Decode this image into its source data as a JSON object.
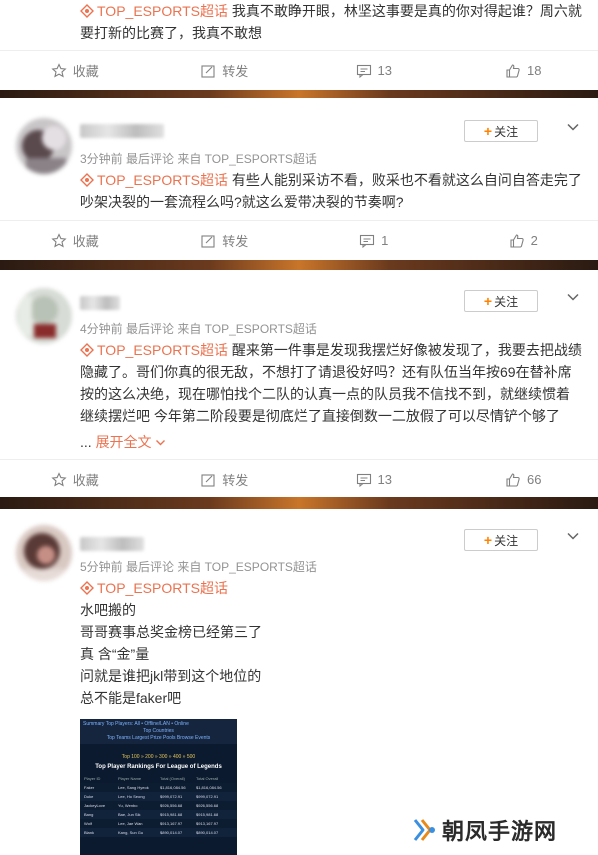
{
  "posts": [
    {
      "text_topic": "TOP_ESPORTS超话",
      "text": " 我真不敢睁开眼，林坚这事要是真的你对得起谁？周六就要打新的比赛了，我真不敢想",
      "actions": {
        "favorite": "收藏",
        "repost": "转发",
        "comments": "13",
        "likes": "18"
      }
    },
    {
      "meta": "3分钟前 最后评论 来自 TOP_ESPORTS超话",
      "follow_label": "关注",
      "text_topic": "TOP_ESPORTS超话",
      "text": " 有些人能别采访不看，败采也不看就这么自问自答走完了吵架决裂的一套流程么吗?就这么爱带决裂的节奏啊?",
      "actions": {
        "favorite": "收藏",
        "repost": "转发",
        "comments": "1",
        "likes": "2"
      }
    },
    {
      "meta": "4分钟前 最后评论 来自 TOP_ESPORTS超话",
      "follow_label": "关注",
      "text_topic": "TOP_ESPORTS超话",
      "text": " 醒来第一件事是发现我摆烂好像被发现了，我要去把战绩隐藏了。哥们你真的很无敌，不想打了请退役好吗？还有队伍当年按69在替补席按的这么决绝，现在哪怕找个二队的认真一点的队员我不信找不到，就继续惯着继续摆烂吧 今年第二阶段要是彻底烂了直接倒数一二放假了可以尽情铲个够了",
      "expand_prefix": "...",
      "expand_label": "展开全文",
      "actions": {
        "favorite": "收藏",
        "repost": "转发",
        "comments": "13",
        "likes": "66"
      }
    },
    {
      "meta": "5分钟前 最后评论 来自 TOP_ESPORTS超话",
      "follow_label": "关注",
      "text_topic": "TOP_ESPORTS超话",
      "lines": [
        "水吧搬的",
        "哥哥赛事总奖金榜已经第三了",
        "真 含“金”量",
        "问就是谁把jkl带到这个地位的",
        "总不能是faker吧"
      ],
      "image": {
        "nav": "Summary   Top Players: All • Offline/LAN • Online",
        "nav2": "Top Countries",
        "nav3": "Top Teams   Largest Prize Pools   Browse Events",
        "pager": "Top 100 » 200 » 300 » 400 » 500",
        "heading": "Top Player Rankings For League of Legends",
        "columns": [
          "Player ID",
          "Player Name",
          "Total (Overall)",
          "Total Overall"
        ],
        "rows": [
          [
            "Faker",
            "Lee, Sang Hyeok",
            "$1,816,084.56",
            "$1,816,084.56"
          ],
          [
            "Duke",
            "Lee, Ho Seong",
            "$999,072.91",
            "$999,072.91"
          ],
          [
            "JackeyLove",
            "Yu, Wenbo",
            "$926,556.68",
            "$926,556.68"
          ],
          [
            "Bang",
            "Bae, Jun Sik",
            "$915,981.68",
            "$915,981.68"
          ],
          [
            "Wolf",
            "Lee, Jae Wan",
            "$913,167.97",
            "$913,167.97"
          ],
          [
            "Blank",
            "Kang, Sun Gu",
            "$890,014.07",
            "$890,014.07"
          ]
        ]
      }
    }
  ],
  "watermark": "朝凤手游网",
  "colors": {
    "topic": "#eb7350",
    "follow_plus": "#ff8200",
    "meta": "#939393"
  }
}
